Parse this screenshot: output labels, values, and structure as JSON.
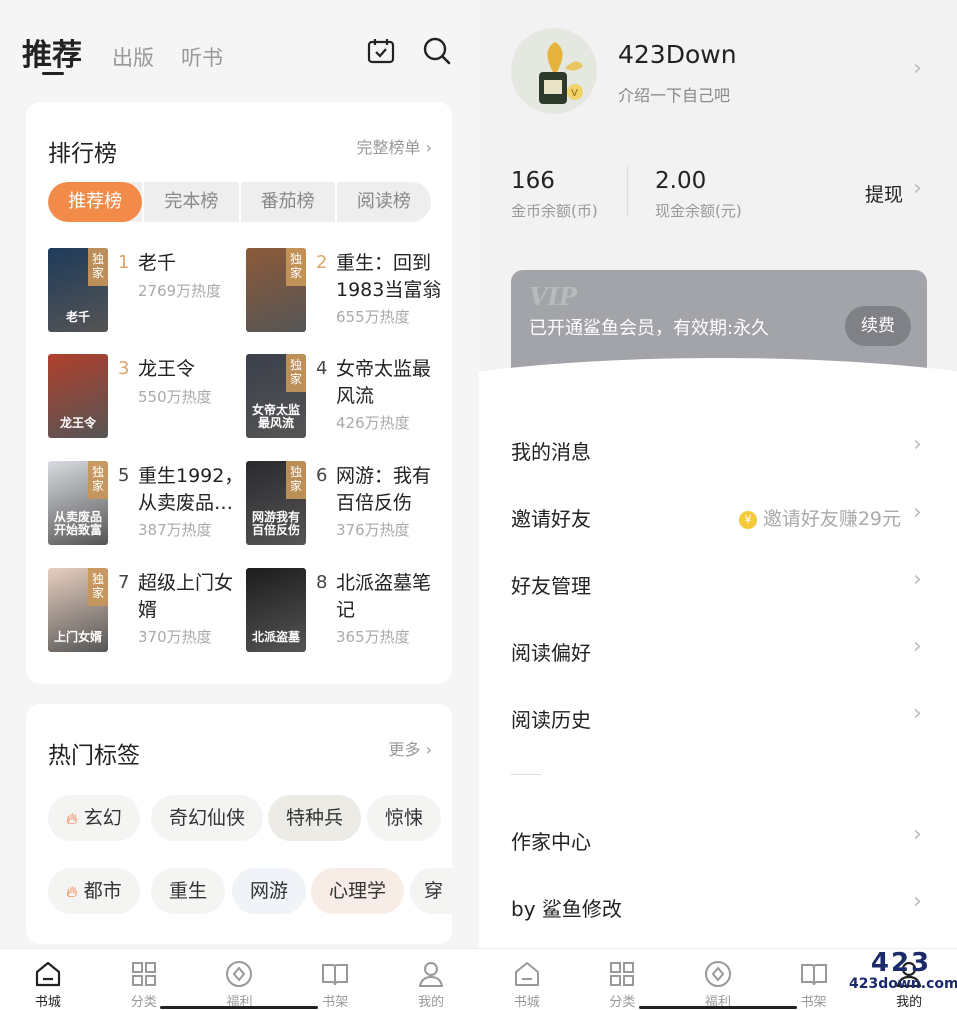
{
  "left": {
    "tabs": {
      "main": "推荐",
      "publish": "出版",
      "audio": "听书"
    },
    "ranking": {
      "title": "排行榜",
      "more": "完整榜单 ›",
      "segments": [
        "推荐榜",
        "完本榜",
        "番茄榜",
        "阅读榜"
      ],
      "items": [
        {
          "rank": "1",
          "title": "老千",
          "heat": "2769万热度",
          "tag": "独家",
          "cover_text": "老千",
          "color": "#1e3a5a"
        },
        {
          "rank": "2",
          "title": "重生：回到1983当富翁",
          "heat": "655万热度",
          "tag": "独家",
          "cover_text": "",
          "color": "#8c5a3a"
        },
        {
          "rank": "3",
          "title": "龙王令",
          "heat": "550万热度",
          "tag": "",
          "cover_text": "龙王令",
          "color": "#b0402c"
        },
        {
          "rank": "4",
          "title": "女帝太监最风流",
          "heat": "426万热度",
          "tag": "独家",
          "cover_text": "女帝太监最风流",
          "color": "#3a3f4a"
        },
        {
          "rank": "5",
          "title": "重生1992，从卖废品…",
          "heat": "387万热度",
          "tag": "独家",
          "cover_text": "从卖废品开始致富",
          "color": "#d8dbe0"
        },
        {
          "rank": "6",
          "title": "网游：我有百倍反伤",
          "heat": "376万热度",
          "tag": "独家",
          "cover_text": "网游我有百倍反伤",
          "color": "#2a2a2e"
        },
        {
          "rank": "7",
          "title": "超级上门女婿",
          "heat": "370万热度",
          "tag": "独家",
          "cover_text": "上门女婿",
          "color": "#e8cfc0"
        },
        {
          "rank": "8",
          "title": "北派盗墓笔记",
          "heat": "365万热度",
          "tag": "",
          "cover_text": "北派盗墓",
          "color": "#1c1c1c"
        }
      ]
    },
    "tags": {
      "title": "热门标签",
      "more": "更多 ›",
      "row1": [
        "玄幻",
        "奇幻仙侠",
        "特种兵",
        "惊悚"
      ],
      "row2": [
        "都市",
        "重生",
        "网游",
        "心理学",
        "穿"
      ]
    },
    "bottom_nav": [
      "书城",
      "分类",
      "福利",
      "书架",
      "我的"
    ]
  },
  "right": {
    "username": "423Down",
    "intro": "介绍一下自己吧",
    "coins": {
      "value": "166",
      "label": "金币余额(币)"
    },
    "cash": {
      "value": "2.00",
      "label": "现金余额(元)"
    },
    "withdraw": "提现",
    "vip": {
      "logo": "VIP",
      "text": "已开通鲨鱼会员，有效期:永久",
      "renew": "续费"
    },
    "menu": [
      "我的消息",
      "邀请好友",
      "好友管理",
      "阅读偏好",
      "阅读历史",
      "作家中心",
      "by 鲨鱼修改"
    ],
    "invite_hint": "邀请好友赚29元",
    "coin_glyph": "¥",
    "bottom_nav": [
      "书城",
      "分类",
      "福利",
      "书架",
      "我的"
    ],
    "watermark": {
      "big": "423",
      "small": "423down.com"
    }
  },
  "colors": {
    "accent": "#f28b4a",
    "rank_top": "#e0a46a",
    "vip_bg": "#a2a4a9"
  }
}
